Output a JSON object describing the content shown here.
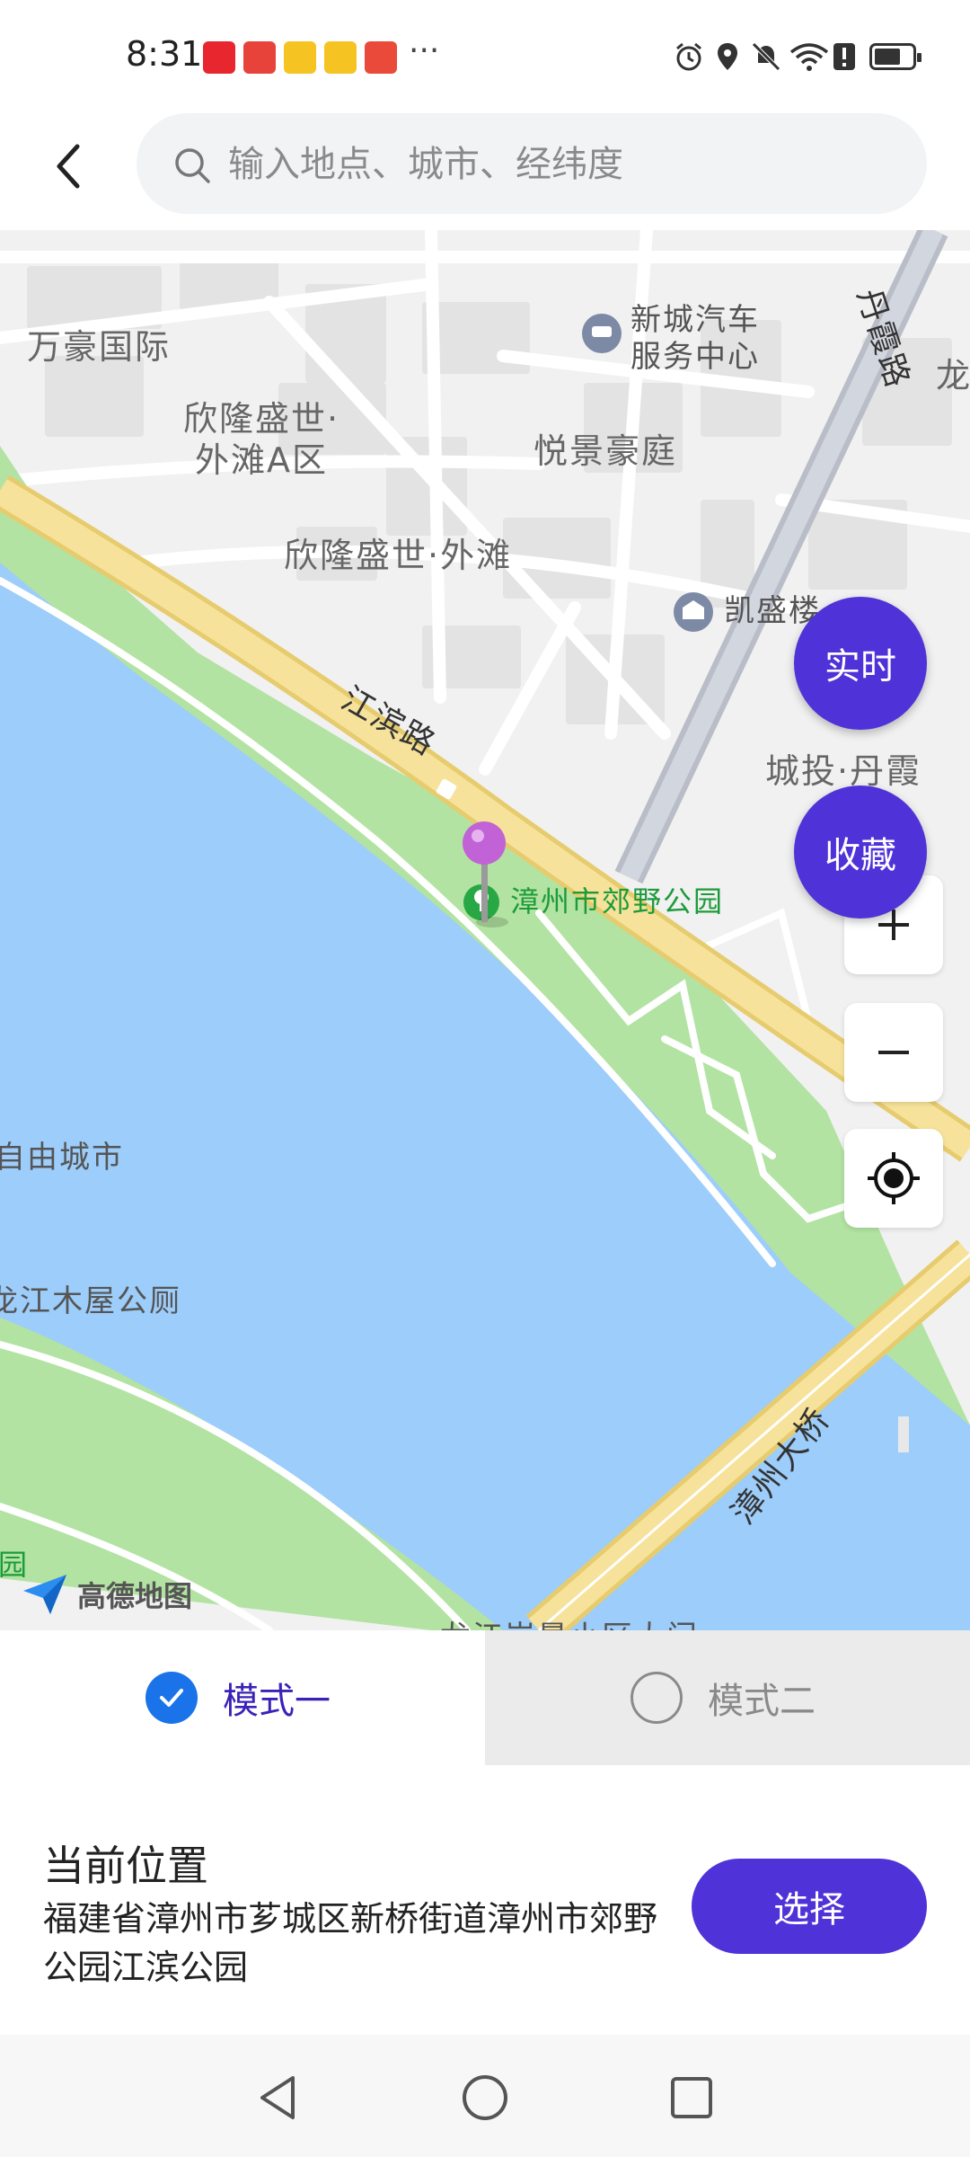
{
  "status_bar": {
    "time": "8:31",
    "more": "···",
    "notification_icons": [
      "taobao-live-icon",
      "huawei-icon",
      "weibo-icon",
      "weibo-icon",
      "shop-icon"
    ],
    "notification_colors": [
      "#e8262d",
      "#e8433a",
      "#f5a623",
      "#f5a623",
      "#e94a3a"
    ],
    "system_icons": [
      "alarm-icon",
      "location-icon",
      "mute-icon",
      "wifi-icon",
      "alert-icon",
      "battery-icon"
    ]
  },
  "search": {
    "placeholder": "输入地点、城市、经纬度",
    "value": ""
  },
  "map": {
    "labels": {
      "wanhao": "万豪国际",
      "xinlong_a": "欣隆盛世·\n外滩A区",
      "xinlong": "欣隆盛世·外滩",
      "yuejing": "悦景豪庭",
      "car_service": "新城汽车\n服务中心",
      "kaisheng": "凯盛楼",
      "chengtou": "城投·丹霞",
      "xia_road": "丹霞路",
      "long": "龙",
      "jiangbin_road": "江滨路",
      "park": "漳州市郊野公园",
      "ziyou": "自由城市",
      "mumu": "龙江木屋公厕",
      "bridge": "漳州大桥",
      "yuan": "园",
      "bottom_cut": "龙江岸景小区大门"
    },
    "brand": "高德地图",
    "colors": {
      "water": "#9dcdfa",
      "park": "#b2e3a2",
      "road_major": "#f6e29a",
      "accent": "#4f33d8",
      "pin": "#c162d6"
    }
  },
  "fab": {
    "realtime": "实时",
    "favorite": "收藏"
  },
  "zoom": {
    "in": "+",
    "out": "−"
  },
  "modes": {
    "mode1": "模式一",
    "mode2": "模式二",
    "selected": "mode1"
  },
  "location": {
    "title": "当前位置",
    "address": "福建省漳州市芗城区新桥街道漳州市郊野公园江滨公园",
    "select_button": "选择"
  }
}
